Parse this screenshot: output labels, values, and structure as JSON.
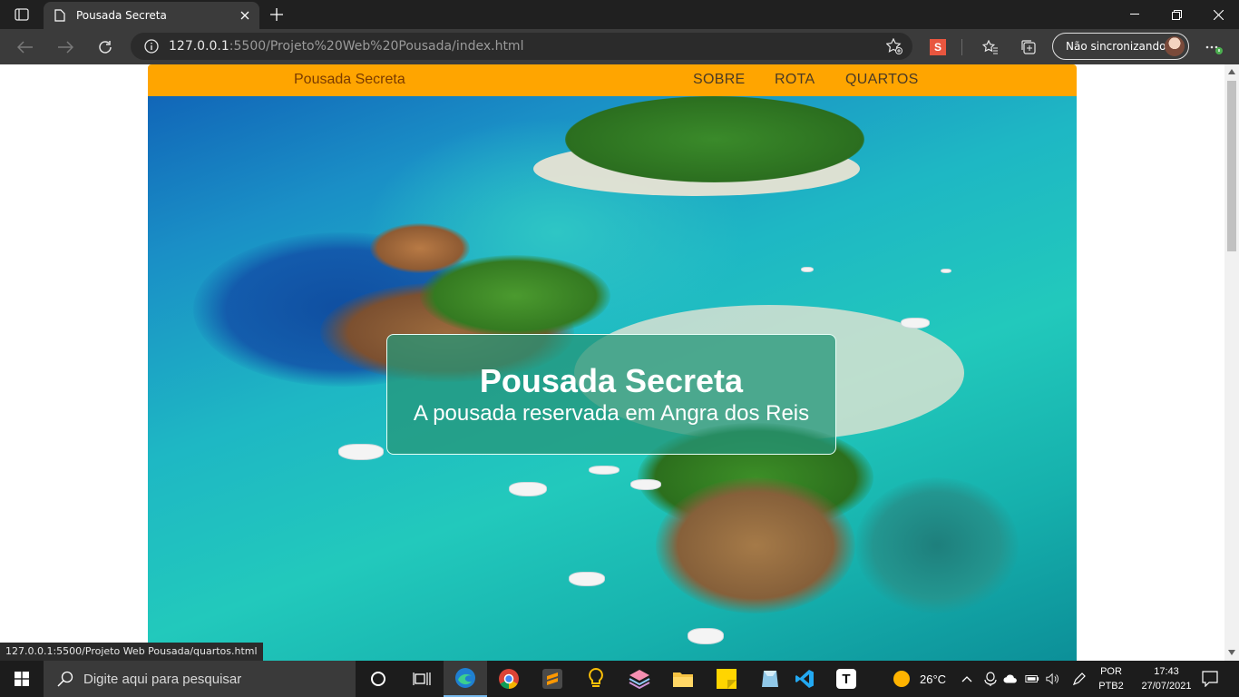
{
  "browser": {
    "tab_title": "Pousada Secreta",
    "address_host": "127.0.0.1",
    "address_rest": ":5500/Projeto%20Web%20Pousada/index.html",
    "profile_label": "Não sincronizando",
    "status_url": "127.0.0.1:5500/Projeto Web Pousada/quartos.html",
    "extension_letter": "S"
  },
  "site": {
    "brand": "Pousada Secreta",
    "nav": [
      "SOBRE",
      "ROTA",
      "QUARTOS"
    ],
    "hero_title": "Pousada Secreta",
    "hero_subtitle": "A pousada reservada em Angra dos Reis"
  },
  "taskbar": {
    "search_placeholder": "Digite aqui para pesquisar",
    "weather": "26°C",
    "lang_top": "POR",
    "lang_bottom": "PTB2",
    "time": "17:43",
    "date": "27/07/2021",
    "notion_letter": "T"
  },
  "colors": {
    "nav_bg": "#ffa500",
    "hero_card": "#269678",
    "chrome_dark": "#202020"
  }
}
